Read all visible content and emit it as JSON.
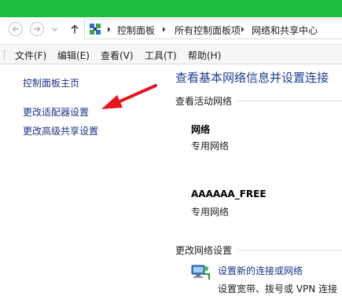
{
  "colors": {
    "title_bar": "#1dbe42",
    "link": "#1e3287",
    "heading": "#1e3c96",
    "annotation_arrow": "#e8141e"
  },
  "toolbar": {
    "back_icon": "back-arrow-icon",
    "forward_icon": "forward-arrow-icon",
    "history_icon": "chevron-down-icon",
    "up_icon": "up-arrow-icon"
  },
  "address": {
    "icon": "control-panel-icon",
    "crumbs": [
      "控制面板",
      "所有控制面板项",
      "网络和共享中心"
    ]
  },
  "menu": {
    "items": [
      "文件(F)",
      "编辑(E)",
      "查看(V)",
      "工具(T)",
      "帮助(H)"
    ]
  },
  "sidebar": {
    "links": [
      "控制面板主页",
      "更改适配器设置",
      "更改高级共享设置"
    ]
  },
  "main": {
    "title": "查看基本网络信息并设置连接",
    "active_networks_label": "查看活动网络",
    "networks": [
      {
        "name": "网络",
        "type": "专用网络"
      },
      {
        "name": "AAAAAA_FREE",
        "type": "专用网络"
      }
    ],
    "change_settings_label": "更改网络设置",
    "actions": [
      {
        "icon": "new-connection-icon",
        "label": "设置新的连接或网络",
        "desc": "设置宽带、拨号或 VPN 连接"
      }
    ]
  }
}
